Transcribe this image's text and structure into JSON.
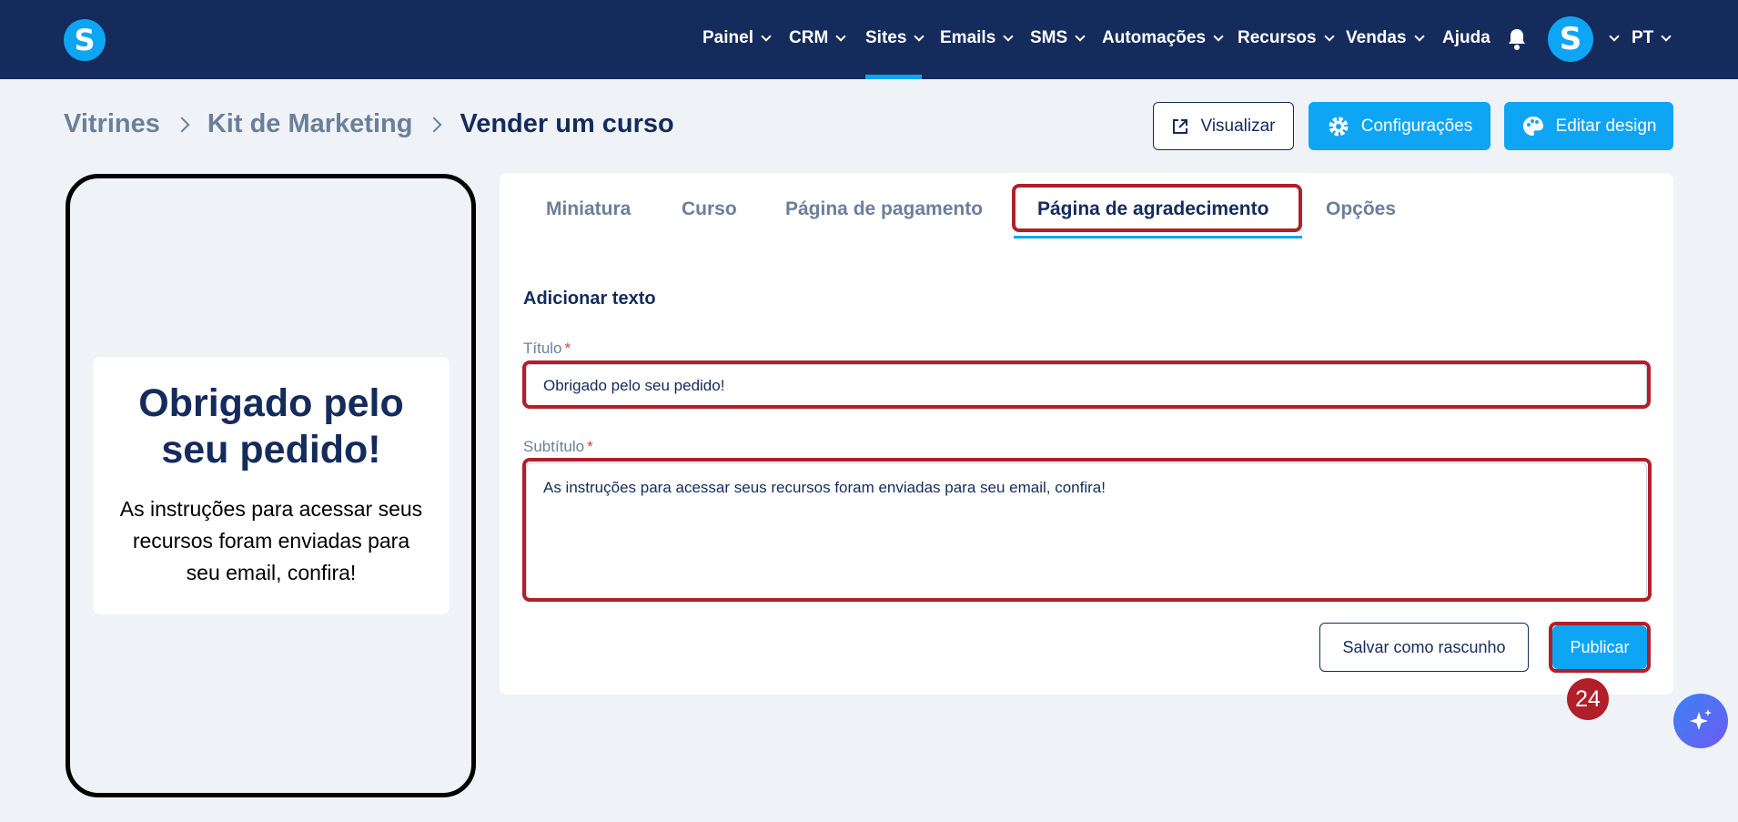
{
  "nav": {
    "items": [
      {
        "label": "Painel",
        "has_dropdown": true
      },
      {
        "label": "CRM",
        "has_dropdown": true
      },
      {
        "label": "Sites",
        "has_dropdown": true,
        "active": true
      },
      {
        "label": "Emails",
        "has_dropdown": true
      },
      {
        "label": "SMS",
        "has_dropdown": true
      },
      {
        "label": "Automações",
        "has_dropdown": true
      },
      {
        "label": "Recursos",
        "has_dropdown": true
      },
      {
        "label": "Vendas",
        "has_dropdown": true
      },
      {
        "label": "Ajuda",
        "has_dropdown": false
      }
    ],
    "logo_letter": "S",
    "avatar_letter": "S",
    "language": "PT",
    "accent_color": "#0ea5f5",
    "bar_color": "#142b5c"
  },
  "breadcrumb": {
    "items": [
      "Vitrines",
      "Kit de Marketing"
    ],
    "current": "Vender um curso"
  },
  "actions": {
    "preview_label": "Visualizar",
    "settings_label": "Configurações",
    "edit_design_label": "Editar design"
  },
  "preview": {
    "title": "Obrigado pelo seu pedido!",
    "subtitle": "As instruções para acessar seus recursos foram enviadas para seu email, confira!"
  },
  "tabs": [
    {
      "label": "Miniatura"
    },
    {
      "label": "Curso"
    },
    {
      "label": "Página de pagamento"
    },
    {
      "label": "Página de agradecimento",
      "active": true
    },
    {
      "label": "Opções"
    }
  ],
  "form": {
    "section_title": "Adicionar texto",
    "title_label": "Título",
    "title_value": "Obrigado pelo seu pedido!",
    "subtitle_label": "Subtítulo",
    "subtitle_value": "As instruções para acessar seus recursos foram enviadas para seu email, confira!",
    "required_mark": "*",
    "save_draft_label": "Salvar como rascunho",
    "publish_label": "Publicar"
  },
  "step_badge": "24",
  "highlight_color": "#b01f2a"
}
